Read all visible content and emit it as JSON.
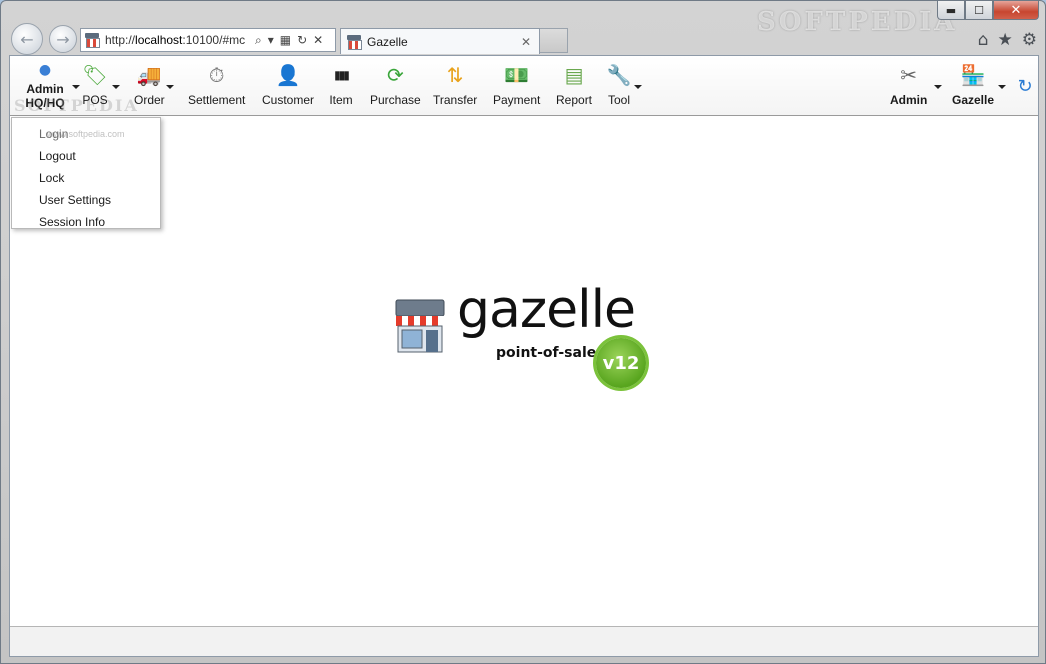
{
  "browser": {
    "watermark": "SOFTPEDIA",
    "address": {
      "prefix": "http://",
      "host": "localhost",
      "rest": ":10100/#mc"
    },
    "tab_title": "Gazelle",
    "window_controls": {
      "minimize": "▬",
      "maximize": "☐",
      "close": "✕"
    },
    "icons": {
      "home": "⌂",
      "favorites": "★",
      "tools": "⚙",
      "back": "←",
      "forward": "→",
      "search": "⌕",
      "dropdown": "▾",
      "compat": "▦",
      "refresh": "↻",
      "stop": "✕",
      "close_tab": "✕"
    }
  },
  "app": {
    "user_menu": {
      "line1": "Admin",
      "line2": "HQ/HQ"
    },
    "faint_watermark": "SOFTPEDIA",
    "small_watermark": "www.softpedia.com",
    "toolbar": [
      {
        "id": "pos",
        "label": "POS",
        "icon": "🏷",
        "color": "#4aa83a"
      },
      {
        "id": "order",
        "label": "Order",
        "icon": "🚚",
        "color": "#555"
      },
      {
        "id": "settlement",
        "label": "Settlement",
        "icon": "⏱",
        "color": "#777"
      },
      {
        "id": "customer",
        "label": "Customer",
        "icon": "👤",
        "color": "#6b4a2e"
      },
      {
        "id": "item",
        "label": "Item",
        "icon": "▮▮▮",
        "color": "#222"
      },
      {
        "id": "purchase",
        "label": "Purchase",
        "icon": "⟳",
        "color": "#3aa53a"
      },
      {
        "id": "transfer",
        "label": "Transfer",
        "icon": "⇅",
        "color": "#e8a21c"
      },
      {
        "id": "payment",
        "label": "Payment",
        "icon": "💵",
        "color": "#4a8a2e"
      },
      {
        "id": "report",
        "label": "Report",
        "icon": "▤",
        "color": "#6aa84f"
      },
      {
        "id": "tool",
        "label": "Tool",
        "icon": "🔧",
        "color": "#555"
      },
      {
        "id": "admin",
        "label": "Admin",
        "icon": "✂",
        "color": "#666"
      },
      {
        "id": "gazelle",
        "label": "Gazelle",
        "icon": "🏪",
        "color": "#555"
      }
    ],
    "refresh_icon": "↻",
    "dropdown": [
      "Login",
      "Logout",
      "Lock",
      "User Settings",
      "Session Info"
    ],
    "logo": {
      "word": "gazelle",
      "subtitle": "point-of-sale",
      "version": "v12"
    }
  }
}
